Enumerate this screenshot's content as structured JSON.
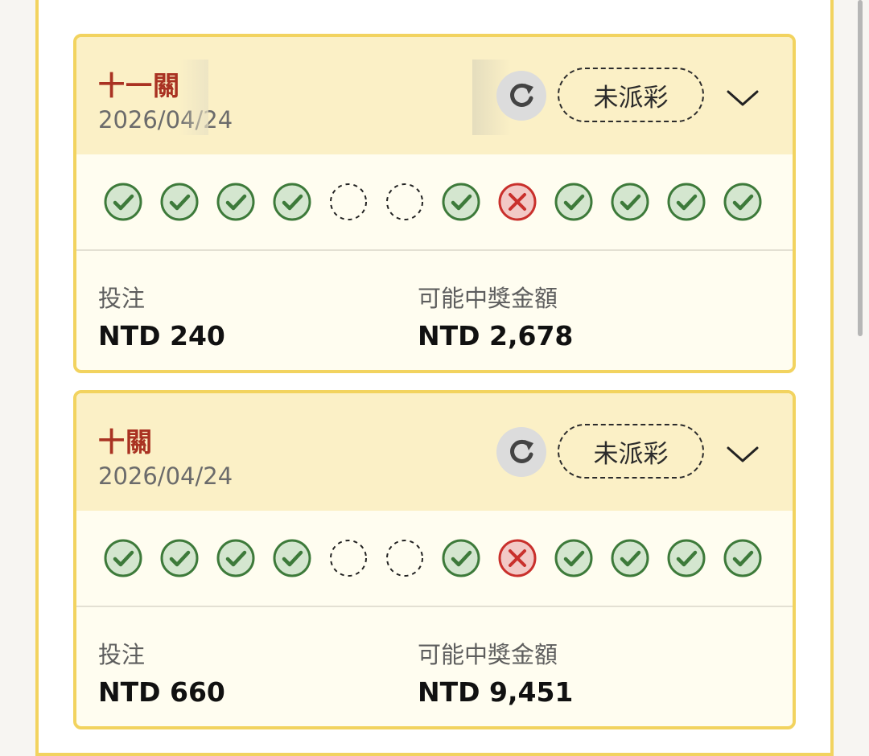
{
  "colors": {
    "accent_border": "#f2d35f",
    "header_bg": "#fbf0c6",
    "title_red": "#a93222",
    "win_green": "#3d7a3a",
    "win_fill": "#d4e6cf",
    "loss_red": "#c9302c",
    "loss_fill": "#f2c9c6"
  },
  "cards": [
    {
      "title": "十一關",
      "date": "2026/04/24",
      "status": "未派彩",
      "refresh_icon": "refresh-icon",
      "expand_icon": "chevron-down-icon",
      "results": [
        "win",
        "win",
        "win",
        "win",
        "pending",
        "pending",
        "win",
        "loss",
        "win",
        "win",
        "win",
        "win"
      ],
      "stake_label": "投注",
      "stake_value": "NTD 240",
      "payout_label": "可能中獎金額",
      "payout_value": "NTD 2,678"
    },
    {
      "title": "十關",
      "date": "2026/04/24",
      "status": "未派彩",
      "refresh_icon": "refresh-icon",
      "expand_icon": "chevron-down-icon",
      "results": [
        "win",
        "win",
        "win",
        "win",
        "pending",
        "pending",
        "win",
        "loss",
        "win",
        "win",
        "win",
        "win"
      ],
      "stake_label": "投注",
      "stake_value": "NTD 660",
      "payout_label": "可能中獎金額",
      "payout_value": "NTD 9,451"
    }
  ]
}
